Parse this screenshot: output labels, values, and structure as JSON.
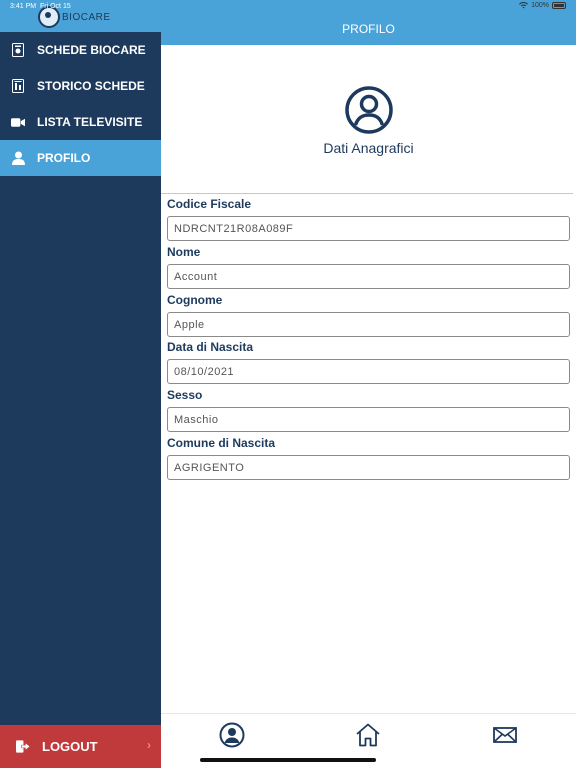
{
  "status_bar": {
    "time": "3:41 PM",
    "date": "Fri Oct 15",
    "battery": "100%"
  },
  "sidebar": {
    "logo_text": "BIOCARE",
    "items": [
      {
        "label": "SCHEDE BIOCARE",
        "icon": "card-icon"
      },
      {
        "label": "STORICO SCHEDE",
        "icon": "archive-icon"
      },
      {
        "label": "LISTA TELEVISITE",
        "icon": "video-icon"
      },
      {
        "label": "PROFILO",
        "icon": "person-icon",
        "active": true
      }
    ],
    "logout_label": "LOGOUT"
  },
  "header": {
    "title": "PROFILO"
  },
  "profile": {
    "section_title": "Dati Anagrafici",
    "fields": [
      {
        "label": "Codice Fiscale",
        "value": "NDRCNT21R08A089F"
      },
      {
        "label": "Nome",
        "value": "Account"
      },
      {
        "label": "Cognome",
        "value": "Apple"
      },
      {
        "label": "Data di Nascita",
        "value": "08/10/2021"
      },
      {
        "label": "Sesso",
        "value": "Maschio"
      },
      {
        "label": "Comune di Nascita",
        "value": "AGRIGENTO"
      }
    ]
  },
  "tabbar": {
    "tabs": [
      "profile-tab-icon",
      "home-icon",
      "mail-icon"
    ]
  },
  "colors": {
    "accent": "#4aa3d8",
    "sidebar": "#1d3a5c",
    "logout": "#c0393b"
  }
}
